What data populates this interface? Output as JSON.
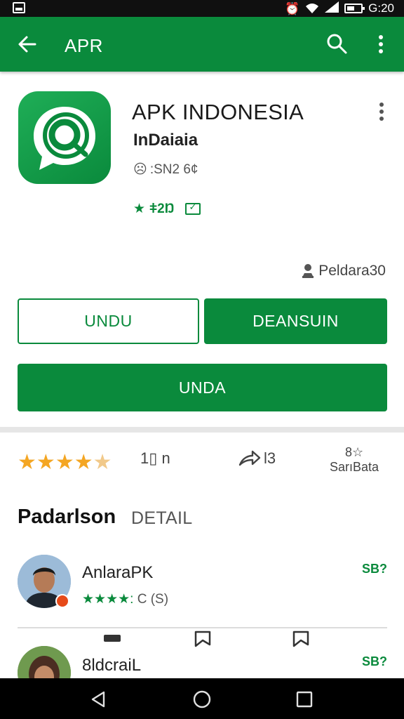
{
  "status_bar": {
    "time": "G:20"
  },
  "app_bar": {
    "title": "APR"
  },
  "app": {
    "title": "APK INDONESIA",
    "developer": "InDaiaia",
    "meta": ":SN2 6¢",
    "rating_text": "★☆²ⁱ⁴⁵⁶⁷",
    "rating_display": "★²⁵²⁶",
    "installs": "Peldara30"
  },
  "buttons": {
    "outline": "UNDU",
    "solid_right": "DEANSUIN",
    "solid_wide": "UNDA"
  },
  "stats": {
    "stars_value": 4.5,
    "downloads": "1▯ n",
    "shares": "l3",
    "similar_top": "8☆",
    "similar_label": "SarıBata"
  },
  "section": {
    "title": "Padarlson",
    "detail": "DETAIL"
  },
  "reviews": [
    {
      "name": "AnlarаPK",
      "stars_text": "★★★★:",
      "extra": " C (S)",
      "side": "SB?"
    },
    {
      "name": "8ldcraiL",
      "side": "SB?"
    }
  ],
  "colors": {
    "primary": "#0a8a3c",
    "star": "#f4a623"
  },
  "icons": {
    "back": "arrow-left-icon",
    "search": "search-icon",
    "more": "more-vert-icon"
  }
}
